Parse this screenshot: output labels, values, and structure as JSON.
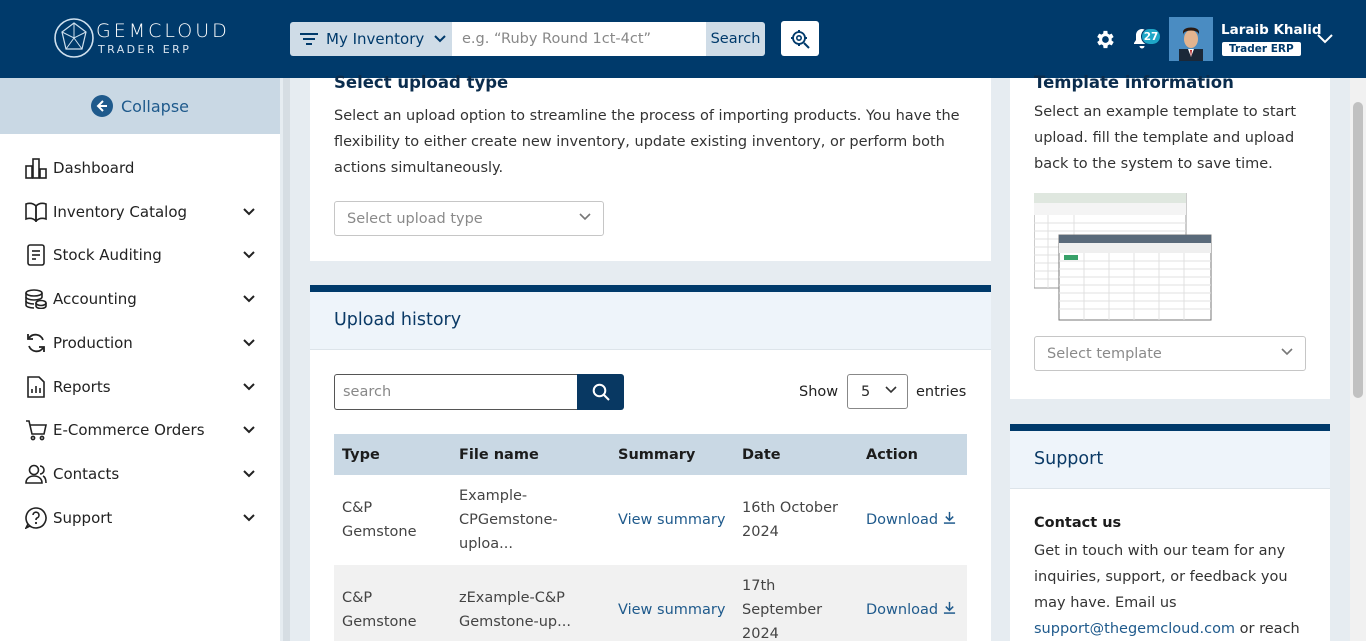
{
  "header": {
    "brand": "GEMCLOUD",
    "brand_sub": "TRADER ERP",
    "inventory_label": "My Inventory",
    "search_placeholder": "e.g. “Ruby Round 1ct-4ct”",
    "search_button": "Search",
    "notification_count": "27",
    "user_name": "Laraib Khalid",
    "user_role": "Trader ERP"
  },
  "sidebar": {
    "collapse_label": "Collapse",
    "items": [
      {
        "label": "Dashboard",
        "icon": "dashboard-icon"
      },
      {
        "label": "Inventory Catalog",
        "icon": "book-icon"
      },
      {
        "label": "Stock Auditing",
        "icon": "clipboard-icon"
      },
      {
        "label": "Accounting",
        "icon": "coins-icon"
      },
      {
        "label": "Production",
        "icon": "refresh-icon"
      },
      {
        "label": "Reports",
        "icon": "report-icon"
      },
      {
        "label": "E-Commerce Orders",
        "icon": "cart-icon"
      },
      {
        "label": "Contacts",
        "icon": "contacts-icon"
      },
      {
        "label": "Support",
        "icon": "help-icon"
      }
    ]
  },
  "upload": {
    "title": "Select upload type",
    "description": "Select an upload option to streamline the process of importing products. You have the flexibility to either create new inventory, update existing inventory, or perform both actions simultaneously.",
    "select_placeholder": "Select upload type"
  },
  "history": {
    "title": "Upload history",
    "search_placeholder": "search",
    "show_label": "Show",
    "show_value": "5",
    "entries_label": "entries",
    "columns": [
      "Type",
      "File name",
      "Summary",
      "Date",
      "Action"
    ],
    "rows": [
      {
        "type": "C&P Gemstone",
        "file": "Example-CPGemstone-uploa...",
        "summary": "View summary",
        "date": "16th October 2024",
        "action": "Download"
      },
      {
        "type": "C&P Gemstone",
        "file": "zExample-C&P Gemstone-up...",
        "summary": "View summary",
        "date": "17th September 2024",
        "action": "Download"
      }
    ]
  },
  "template": {
    "title": "Template information",
    "description": "Select an example template to start upload. fill the template and upload back to the system to save time.",
    "select_placeholder": "Select template"
  },
  "support": {
    "title": "Support",
    "contact_title": "Contact us",
    "contact_text": "Get in touch with our team for any inquiries, support, or feedback you may have. Email us",
    "email": "support@thegemcloud.com",
    "contact_tail": "or reach"
  },
  "colors": {
    "primary": "#003a6b",
    "accent": "#1f5a8c",
    "badge": "#1ea6c7"
  }
}
